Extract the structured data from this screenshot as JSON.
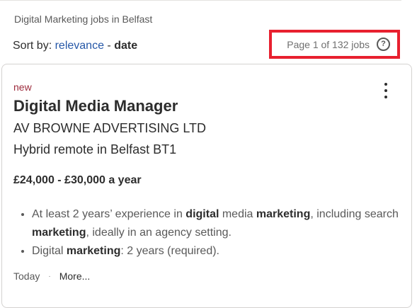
{
  "breadcrumb": "Digital Marketing jobs in Belfast",
  "sort": {
    "label": "Sort by:",
    "option_relevance": "relevance",
    "separator": "-",
    "option_date": "date"
  },
  "page_count": {
    "text": "Page 1 of 132 jobs",
    "help_icon": "question-circle-icon",
    "highlight_color": "#e8202f"
  },
  "job": {
    "badge": "new",
    "title": "Digital Media Manager",
    "company": "AV BROWNE ADVERTISING LTD",
    "location": "Hybrid remote in Belfast BT1",
    "salary": "£24,000 - £30,000 a year",
    "snippet": [
      [
        {
          "t": "At least 2 years’ experience in ",
          "b": false
        },
        {
          "t": "digital",
          "b": true
        },
        {
          "t": " media ",
          "b": false
        },
        {
          "t": "marketing",
          "b": true
        },
        {
          "t": ", including search ",
          "b": false
        },
        {
          "t": "marketing",
          "b": true
        },
        {
          "t": ", ideally in an agency setting.",
          "b": false
        }
      ],
      [
        {
          "t": "Digital ",
          "b": false
        },
        {
          "t": "marketing",
          "b": true
        },
        {
          "t": ": 2 years (required).",
          "b": false
        }
      ]
    ],
    "posted": "Today",
    "more_link": "More..."
  },
  "colors": {
    "link": "#2557a7",
    "new_badge": "#9d2b3c"
  }
}
